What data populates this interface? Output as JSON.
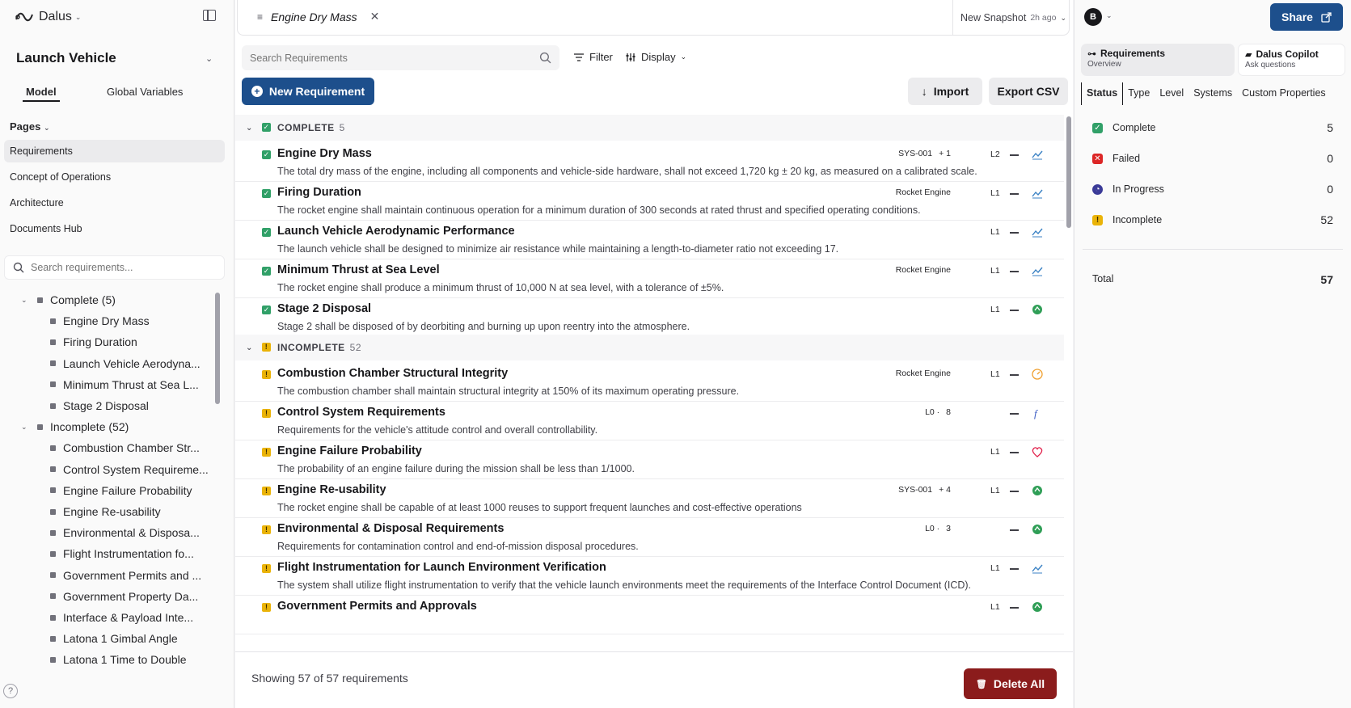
{
  "app": {
    "name": "Dalus"
  },
  "left": {
    "project": "Launch Vehicle",
    "tabs": [
      {
        "label": "Model"
      },
      {
        "label": "Global Variables"
      }
    ],
    "pages_label": "Pages",
    "nav": [
      {
        "label": "Requirements"
      },
      {
        "label": "Concept of Operations"
      },
      {
        "label": "Architecture"
      },
      {
        "label": "Documents Hub"
      }
    ],
    "search_placeholder": "Search requirements...",
    "tree": [
      {
        "label": "Complete (5)",
        "group": true
      },
      {
        "label": "Engine Dry Mass"
      },
      {
        "label": "Firing Duration"
      },
      {
        "label": "Launch Vehicle Aerodyna..."
      },
      {
        "label": "Minimum Thrust at Sea L..."
      },
      {
        "label": "Stage 2 Disposal"
      },
      {
        "label": "Incomplete (52)",
        "group": true
      },
      {
        "label": "Combustion Chamber Str..."
      },
      {
        "label": "Control System Requireme..."
      },
      {
        "label": "Engine Failure Probability"
      },
      {
        "label": "Engine Re-usability"
      },
      {
        "label": "Environmental & Disposa..."
      },
      {
        "label": "Flight Instrumentation fo..."
      },
      {
        "label": "Government Permits and ..."
      },
      {
        "label": "Government Property Da..."
      },
      {
        "label": "Interface & Payload Inte..."
      },
      {
        "label": "Latona 1 Gimbal Angle"
      },
      {
        "label": "Latona 1 Time to Double"
      }
    ],
    "help": "?"
  },
  "main": {
    "tab_title": "Engine Dry Mass",
    "snapshot": {
      "label": "New Snapshot",
      "ago": "2h ago"
    },
    "search_placeholder": "Search Requirements",
    "filter_label": "Filter",
    "display_label": "Display",
    "new_label": "New Requirement",
    "import_label": "Import",
    "export_label": "Export CSV",
    "groups": [
      {
        "title": "COMPLETE",
        "count": "5",
        "status": "complete",
        "rows": [
          {
            "title": "Engine Dry Mass",
            "desc": "The total dry mass of the engine, including all components and vehicle-side hardware, shall not exceed 1,720 kg ± 20 kg, as measured on a calibrated scale.",
            "meta": [
              "SYS-001",
              "+ 1"
            ],
            "level": "L2",
            "icon": "chart"
          },
          {
            "title": "Firing Duration",
            "desc": "The rocket engine shall maintain continuous operation for a minimum duration of 300 seconds at rated thrust and specified operating conditions.",
            "meta": [
              "Rocket Engine"
            ],
            "level": "L1",
            "icon": "chart"
          },
          {
            "title": "Launch Vehicle Aerodynamic Performance",
            "desc": "The launch vehicle shall be designed to minimize air resistance while maintaining a length-to-diameter ratio not exceeding 17.",
            "meta": [],
            "level": "L1",
            "icon": "chart"
          },
          {
            "title": "Minimum Thrust at Sea Level",
            "desc": "The rocket engine shall produce a minimum thrust of 10,000 N at sea level, with a tolerance of ±5%.",
            "meta": [
              "Rocket Engine"
            ],
            "level": "L1",
            "icon": "chart"
          },
          {
            "title": "Stage 2 Disposal",
            "desc": "Stage 2 shall be disposed of by deorbiting and burning up upon reentry into the atmosphere.",
            "meta": [],
            "level": "L1",
            "icon": "recycle"
          }
        ]
      },
      {
        "title": "INCOMPLETE",
        "count": "52",
        "status": "incomplete",
        "rows": [
          {
            "title": "Combustion Chamber Structural Integrity",
            "desc": "The combustion chamber shall maintain structural integrity at 150% of its maximum operating pressure.",
            "meta": [
              "Rocket Engine"
            ],
            "level": "L1",
            "icon": "gauge"
          },
          {
            "title": "Control System Requirements",
            "desc": "Requirements for the vehicle's attitude control and overall controllability.",
            "meta": [
              "L0 ·",
              "8"
            ],
            "level": "",
            "icon": "function"
          },
          {
            "title": "Engine Failure Probability",
            "desc": "The probability of an engine failure during the mission shall be less than 1/1000.",
            "meta": [],
            "level": "L1",
            "icon": "heart"
          },
          {
            "title": "Engine Re-usability",
            "desc": "The rocket engine shall be capable of at least 1000 reuses to support frequent launches and cost-effective operations",
            "meta": [
              "SYS-001",
              "+ 4"
            ],
            "level": "L1",
            "icon": "recycle"
          },
          {
            "title": "Environmental & Disposal Requirements",
            "desc": "Requirements for contamination control and end-of-mission disposal procedures.",
            "meta": [
              "L0 ·",
              "3"
            ],
            "level": "",
            "icon": "recycle"
          },
          {
            "title": "Flight Instrumentation for Launch Environment Verification",
            "desc": "The system shall utilize flight instrumentation to verify that the vehicle launch environments meet the requirements of the Interface Control Document (ICD).",
            "meta": [],
            "level": "L1",
            "icon": "chart"
          },
          {
            "title": "Government Permits and Approvals",
            "desc": "",
            "meta": [],
            "level": "L1",
            "icon": "recycle"
          }
        ]
      }
    ],
    "showing": "Showing 57 of 57 requirements",
    "delete_label": "Delete All"
  },
  "right": {
    "avatar": "B",
    "share_label": "Share",
    "cards": [
      {
        "title": "Requirements",
        "sub": "Overview"
      },
      {
        "title": "Dalus Copilot",
        "sub": "Ask questions"
      }
    ],
    "tabs": [
      {
        "label": "Status"
      },
      {
        "label": "Type"
      },
      {
        "label": "Level"
      },
      {
        "label": "Systems"
      },
      {
        "label": "Custom Properties"
      }
    ],
    "stats": [
      {
        "label": "Complete",
        "value": "5",
        "color": "#31a068"
      },
      {
        "label": "Failed",
        "value": "0",
        "color": "#dc2626"
      },
      {
        "label": "In Progress",
        "value": "0",
        "color": "#3b3b98"
      },
      {
        "label": "Incomplete",
        "value": "52",
        "color": "#eab308"
      }
    ],
    "total_label": "Total",
    "total_value": "57"
  }
}
